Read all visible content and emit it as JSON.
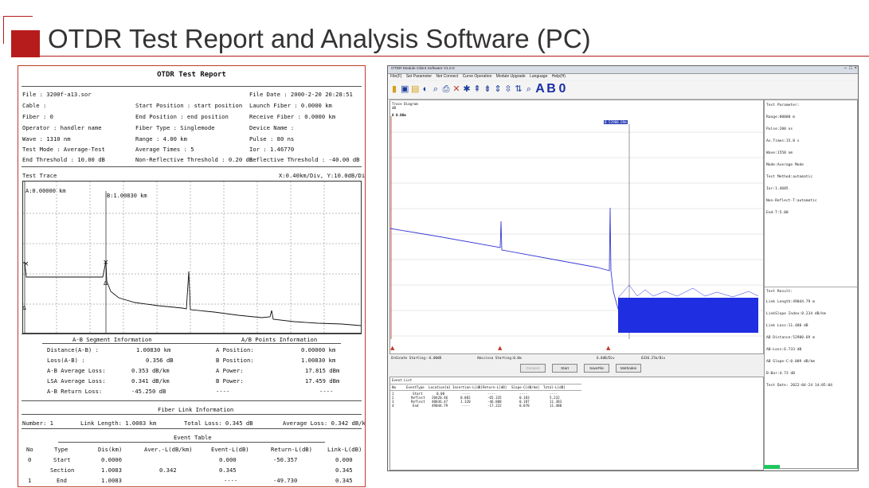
{
  "slide": {
    "title": "OTDR Test Report and Analysis Software (PC)"
  },
  "report": {
    "title": "OTDR Test Report",
    "info": {
      "file": "File : 3200f-a13.sor",
      "file_date": "File Date : 2000-2-20 20:28:51",
      "cable": "Cable :",
      "start_position": "Start Position : start position",
      "launch_fiber": "Launch Fiber : 0.0000 km",
      "fiber": "Fiber : 0",
      "end_position": "End Position : end position",
      "receive_fiber": "Receive Fiber : 0.0000 km",
      "operator": "Operator : handler name",
      "fiber_type": "Fiber Type : Singlemode",
      "device_name": "Device Name :",
      "wave": "Wave : 1310 nm",
      "range": "Range : 4.00 km",
      "pulse": "Pulse : 80 ns",
      "test_mode": "Test Mode : Average-Test",
      "average_times": "Average Times : 5",
      "ior": "Ior : 1.46770",
      "end_threshold": "End Threshold : 10.00 dB",
      "non_reflective_threshold": "Non-Reflective Threshold : 0.20 dB",
      "reflective_threshold": "Reflective Threshold : -40.00 dB"
    },
    "test_trace": {
      "label": "Test Trace",
      "scale": "X:0.40km/Div, Y:10.0dB/Div",
      "marker_a": "A:0.00000 km",
      "marker_b": "B:1.00830 km"
    },
    "ab_segment": {
      "title": "A-B Segment Information",
      "rows": [
        {
          "label": "Distance(A-B) :",
          "value": "1.00830 km"
        },
        {
          "label": "Loss(A-B) :",
          "value": "0.356 dB"
        },
        {
          "label": "A-B Average Loss:",
          "value": "0.353 dB/km"
        },
        {
          "label": "LSA Average Loss:",
          "value": "0.341 dB/km"
        },
        {
          "label": "A-B Return Loss:",
          "value": "-45.250 dB"
        }
      ]
    },
    "ab_points": {
      "title": "A/B Points Information",
      "rows": [
        {
          "label": "A Position:",
          "value": "0.00000 km"
        },
        {
          "label": "B Position:",
          "value": "1.00830 km"
        },
        {
          "label": "A Power:",
          "value": "17.815 dBm"
        },
        {
          "label": "B Power:",
          "value": "17.459 dBm"
        },
        {
          "label": "----",
          "value": "----"
        }
      ]
    },
    "fiber_link": {
      "title": "Fiber Link Information",
      "number": "Number: 1",
      "link_length": "Link Length: 1.0083 km",
      "total_loss": "Total Loss: 0.345 dB",
      "average_loss": "Average Loss: 0.342 dB/km"
    },
    "event_table": {
      "title": "Event Table",
      "headers": [
        "No",
        "Type",
        "Dis(km)",
        "Aver.-L(dB/km)",
        "Event-L(dB)",
        "Return-L(dB)",
        "Link-L(dB)"
      ],
      "rows": [
        [
          "0",
          "Start",
          "0.0000",
          "",
          "0.000",
          "-50.357",
          "0.000"
        ],
        [
          "",
          "Section",
          "1.0083",
          "0.342",
          "0.345",
          "",
          "0.345"
        ],
        [
          "1",
          "End",
          "1.0083",
          "",
          "----",
          "-49.730",
          "0.345"
        ]
      ]
    }
  },
  "app": {
    "window_title": "OTDR Module Client Software V1.0.0",
    "menu": [
      "File(F)",
      "Set Parameter",
      "Net Connect",
      "Curve Operation",
      "Module Upgrade",
      "Language",
      "Help(H)"
    ],
    "toolbar_letters": [
      "A",
      "B",
      "0"
    ],
    "plot": {
      "title": "Trace Diagram",
      "unit": "dB",
      "a_marker": "A 0.00m",
      "b_marker": "B 52980.69m",
      "ordinate_start": "Ordinate Starting:-6.00dB",
      "abscissa_start": "Abscissa Starting:0.0m",
      "y_per_div": "6.0dB/Div",
      "x_per_div": "6336.27m/Div"
    },
    "buttons": {
      "connect": "Connect",
      "start": "Start",
      "save_file": "SaveFile",
      "methodes": "Methodes"
    },
    "test_parameter": {
      "title": "Test Parameter:",
      "lines": [
        "Range:80000 m",
        "Pulse:200 ns",
        "Av.Times:15.0 s",
        "Wave:1550 nm",
        "Mode:Average Mode",
        "Test Method:automatic",
        "Ior:1.4685",
        "Non-Reflect-T:automatic",
        "End-T:5.00"
      ]
    },
    "test_result": {
      "title": "Test Result:",
      "lines": [
        "Link Length:49044.79 m",
        "LinkSlope Index:0.234 dB/km",
        "Link Loss:11.480 dB",
        "AB Distance:52980.69 m",
        "AB-Loss:6.733 dB",
        "AB Slope-C:0.009 dB/km",
        "B-Bar:4.73 dB",
        "Test Date: 2022-04-24 14:05:04"
      ]
    },
    "event_list": {
      "title": "Event List",
      "headers": [
        "No",
        "EventType",
        "Location[m]",
        "Insertion-L[dB]",
        "Return-L[dB]",
        "Slope-C[dB/km]",
        "Total-L[dB]"
      ],
      "rows": [
        [
          "1",
          "Start",
          "0.00",
          "----",
          "----",
          "----",
          "----"
        ],
        [
          "2",
          "Reflect",
          "20420.46",
          "0.082",
          "-65.335",
          "0.183",
          "5.232"
        ],
        [
          "3",
          "Reflect",
          "40036.47",
          "1.320",
          "-46.808",
          "0.187",
          "11.383"
        ],
        [
          "4",
          "End",
          "49044.79",
          "----",
          "-17.222",
          "0.070",
          "11.480"
        ]
      ]
    }
  }
}
